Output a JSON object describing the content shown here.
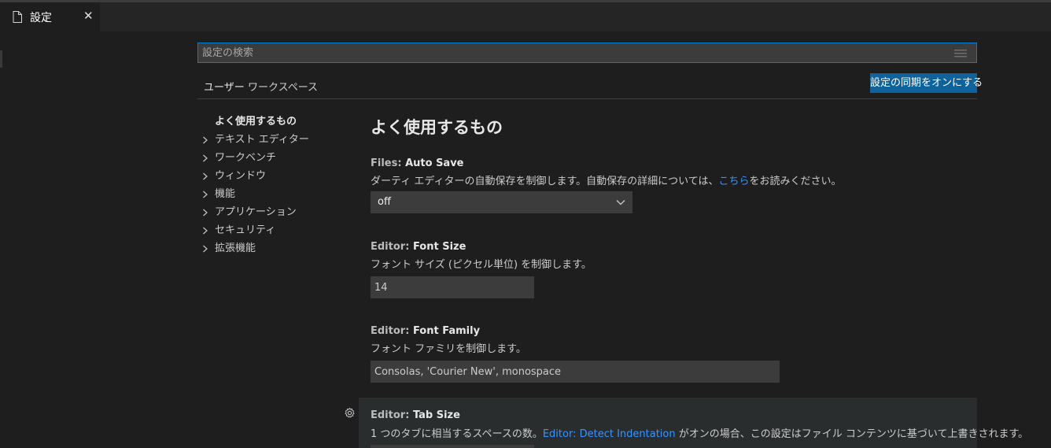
{
  "tab": {
    "label": "設定",
    "close": "✕"
  },
  "search": {
    "placeholder": "設定の検索"
  },
  "scopes": [
    {
      "label": "ユーザー",
      "active": true
    },
    {
      "label": "ワークスペース",
      "active": false
    }
  ],
  "sync_button": "設定の同期をオンにする",
  "toc": [
    {
      "label": "よく使用するもの",
      "expandable": false
    },
    {
      "label": "テキスト エディター",
      "expandable": true
    },
    {
      "label": "ワークベンチ",
      "expandable": true
    },
    {
      "label": "ウィンドウ",
      "expandable": true
    },
    {
      "label": "機能",
      "expandable": true
    },
    {
      "label": "アプリケーション",
      "expandable": true
    },
    {
      "label": "セキュリティ",
      "expandable": true
    },
    {
      "label": "拡張機能",
      "expandable": true
    }
  ],
  "group_title": "よく使用するもの",
  "settings": {
    "auto_save": {
      "category": "Files: ",
      "key": "Auto Save",
      "desc_before": "ダーティ エディターの自動保存を制御します。自動保存の詳細については、",
      "desc_link": "こちら",
      "desc_after": "をお読みください。",
      "value": "off"
    },
    "font_size": {
      "category": "Editor: ",
      "key": "Font Size",
      "desc": "フォント サイズ (ピクセル単位) を制御します。",
      "value": "14"
    },
    "font_family": {
      "category": "Editor: ",
      "key": "Font Family",
      "desc": "フォント ファミリを制御します。",
      "value": "Consolas, 'Courier New', monospace"
    },
    "tab_size": {
      "category": "Editor: ",
      "key": "Tab Size",
      "desc_before": "1 つのタブに相当するスペースの数。",
      "desc_link": "Editor: Detect Indentation",
      "desc_after": " がオンの場合、この設定はファイル コンテンツに基づいて上書きされます。"
    }
  },
  "colors": {
    "accent": "#007fd4",
    "button": "#0e639c",
    "link": "#3794ff",
    "background": "#1e1e1e"
  }
}
